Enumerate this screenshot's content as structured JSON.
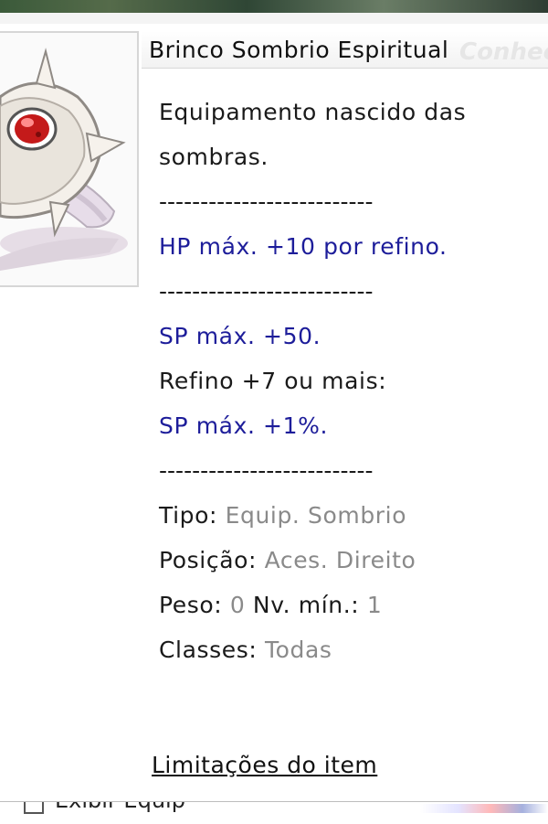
{
  "window": {
    "title": "Brinco Sombrio Espiritual",
    "title_watermark": "Conhec"
  },
  "item": {
    "image_name": "earring-icon",
    "description": [
      {
        "text": "Equipamento nascido das",
        "style": "normal"
      },
      {
        "text": "sombras.",
        "style": "normal"
      },
      {
        "text": "--------------------------",
        "style": "sep"
      },
      {
        "text": "HP máx. +10 por refino.",
        "style": "blue"
      },
      {
        "text": "--------------------------",
        "style": "sep"
      },
      {
        "text": "SP máx. +50.",
        "style": "blue"
      },
      {
        "text": "Refino +7 ou mais:",
        "style": "normal"
      },
      {
        "text": "SP máx. +1%.",
        "style": "blue"
      },
      {
        "text": "--------------------------",
        "style": "sep"
      }
    ],
    "attributes": {
      "type_label": "Tipo:",
      "type_value": "Equip. Sombrio",
      "position_label": "Posição:",
      "position_value": "Aces. Direito",
      "weight_label": "Peso:",
      "weight_value": "0",
      "level_label": "Nv. mín.:",
      "level_value": "1",
      "classes_label": "Classes:",
      "classes_value": "Todas"
    }
  },
  "links": {
    "limitations": "Limitações do item"
  },
  "background": {
    "bottom_text": "Exibir Equip"
  },
  "colors": {
    "blue_text": "#1d1d9a",
    "gray_value": "#8a8a8a",
    "gem_red": "#c41a1a"
  }
}
